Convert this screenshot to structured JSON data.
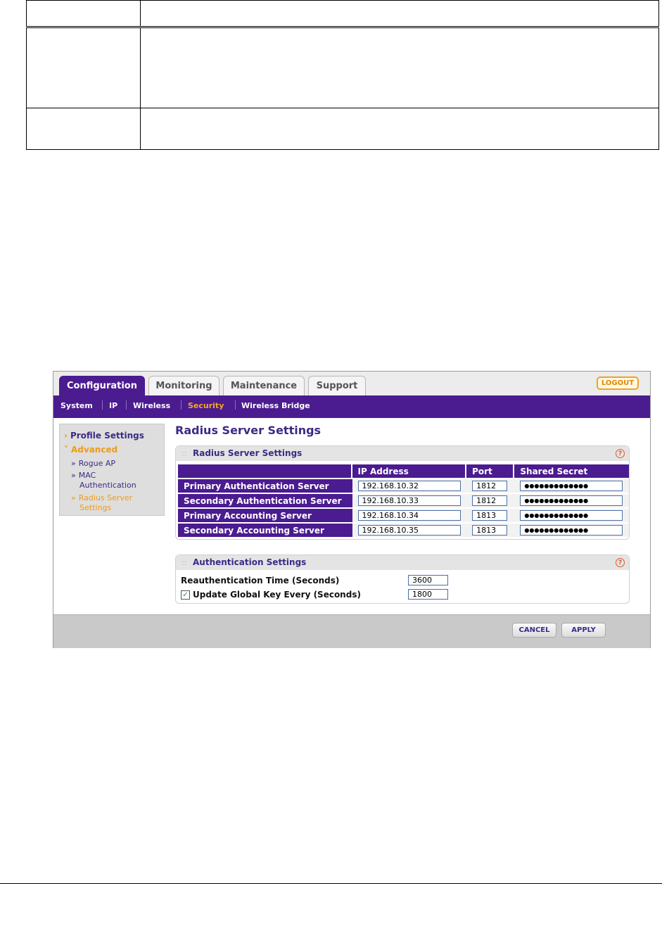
{
  "tabs": [
    {
      "label": "Configuration",
      "active": true
    },
    {
      "label": "Monitoring",
      "active": false
    },
    {
      "label": "Maintenance",
      "active": false
    },
    {
      "label": "Support",
      "active": false
    }
  ],
  "logout_label": "LOGOUT",
  "subnav": [
    {
      "label": "System",
      "active": false
    },
    {
      "label": "IP",
      "active": false
    },
    {
      "label": "Wireless",
      "active": false
    },
    {
      "label": "Security",
      "active": true
    },
    {
      "label": "Wireless Bridge",
      "active": false
    }
  ],
  "sidebar": {
    "profile_settings": "Profile Settings",
    "advanced": "Advanced",
    "rogue_ap": "Rogue AP",
    "mac_auth_line1": "MAC",
    "mac_auth_line2": "Authentication",
    "radius_line1": "Radius Server",
    "radius_line2": "Settings"
  },
  "page_title": "Radius Server Settings",
  "radius_panel": {
    "title": "Radius Server Settings",
    "columns": [
      "IP Address",
      "Port",
      "Shared Secret"
    ],
    "rows": [
      {
        "label": "Primary Authentication Server",
        "ip": "192.168.10.32",
        "port": "1812",
        "secret": "●●●●●●●●●●●●●"
      },
      {
        "label": "Secondary Authentication Server",
        "ip": "192.168.10.33",
        "port": "1812",
        "secret": "●●●●●●●●●●●●●"
      },
      {
        "label": "Primary Accounting Server",
        "ip": "192.168.10.34",
        "port": "1813",
        "secret": "●●●●●●●●●●●●●"
      },
      {
        "label": "Secondary Accounting Server",
        "ip": "192.168.10.35",
        "port": "1813",
        "secret": "●●●●●●●●●●●●●"
      }
    ]
  },
  "auth_panel": {
    "title": "Authentication Settings",
    "reauth_label": "Reauthentication Time (Seconds)",
    "reauth_value": "3600",
    "update_label": "Update Global Key Every (Seconds)",
    "update_checked": true,
    "update_value": "1800"
  },
  "buttons": {
    "cancel": "CANCEL",
    "apply": "APPLY"
  },
  "colors": {
    "brand_purple": "#4b1b90",
    "accent_orange": "#f5a623"
  },
  "icons": {
    "help": "help-icon",
    "check": "checkbox-checked-icon"
  }
}
